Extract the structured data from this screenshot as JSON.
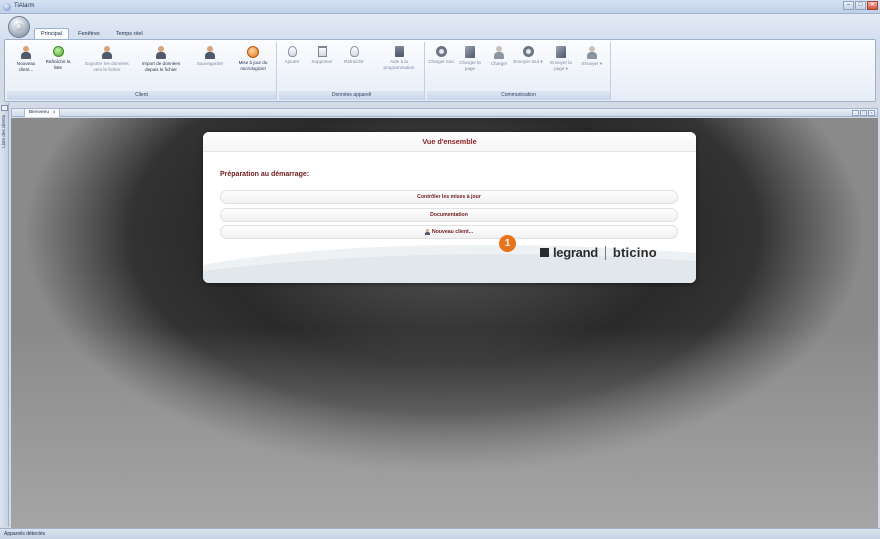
{
  "window": {
    "title": "TiAlarm",
    "controls": [
      "–",
      "□",
      "✕"
    ]
  },
  "ribbon": {
    "tabs": [
      "Principal",
      "Fenêtres",
      "Temps réel"
    ],
    "active_tab": "Principal",
    "groups": {
      "client": {
        "label": "Client",
        "buttons": {
          "nouveau_client": "Nouveau client...",
          "rafraichir_liste": "Rafraîchir la liste",
          "exporter": "Exporter les données vers le fichier",
          "importer": "Import de données depuis le fichier",
          "sauvegarder": "Sauvegarder",
          "mise_a_jour": "Mise à jour du micrologiciel"
        }
      },
      "donnees_appareil": {
        "label": "Données appareil",
        "buttons": {
          "ajouter": "Ajouter",
          "supprimer": "Supprimer",
          "rafraichir": "Rafraîchir",
          "aide_programmation": "Aide à la programmation"
        }
      },
      "communication": {
        "label": "Communication",
        "buttons": {
          "charger_tout": "Charger tout",
          "charger_page": "Charger la page",
          "charger": "Charger",
          "envoyer_tout": "Envoyer tout ▾",
          "envoyer_page": "Envoyer la page ▾",
          "envoyer": "Envoyer ▾"
        }
      }
    }
  },
  "sidebar": {
    "label": "Liste des clients"
  },
  "document_tab": {
    "label": "Bienvenu",
    "close": "x"
  },
  "overview": {
    "title": "Vue d'ensemble",
    "section_title": "Préparation au démarrage:",
    "options": {
      "check_updates": "Contrôler les mises à jour",
      "documentation": "Documentation",
      "new_client": "Nouveau client..."
    },
    "logo_legrand": "legrand",
    "logo_bticino": "bticino"
  },
  "callout": {
    "number": "1",
    "color": "#e8731b"
  },
  "statusbar": {
    "text": "Appareils détectés"
  }
}
